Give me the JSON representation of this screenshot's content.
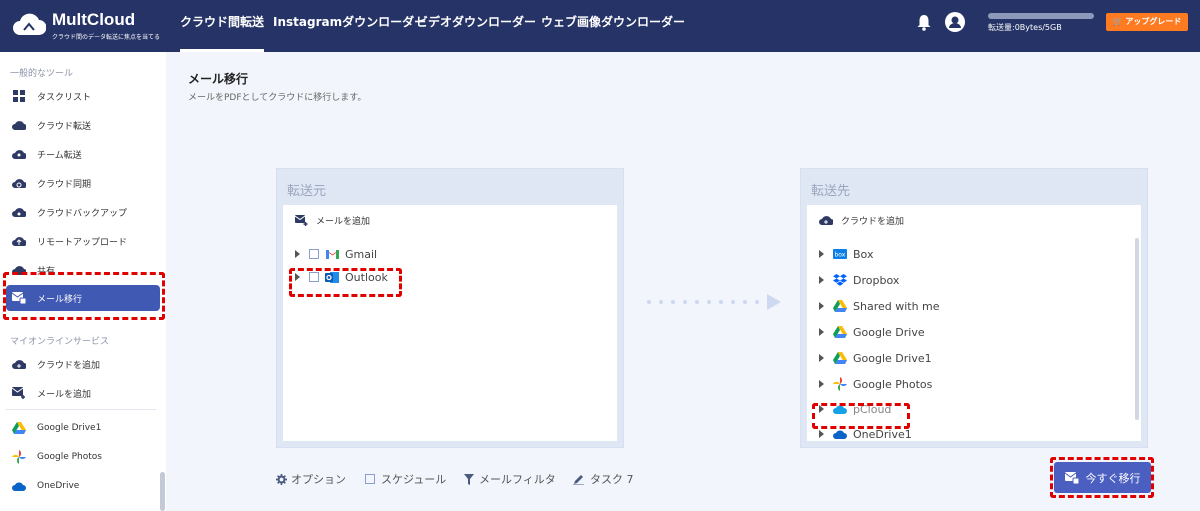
{
  "app": {
    "name": "MultCloud",
    "tagline": "クラウド間のデータ転送に焦点を当てる"
  },
  "topnav": [
    {
      "label": "クラウド間転送",
      "active": true
    },
    {
      "label": "Instagramダウンローダー",
      "active": false
    },
    {
      "label": "ビデオダウンローダー",
      "active": false
    },
    {
      "label": "ウェブ画像ダウンローダー",
      "active": false
    }
  ],
  "header": {
    "usage": "転送量:0Bytes/5GB",
    "usage_fraction": 0,
    "upgrade": "アップグレード"
  },
  "sidebar": {
    "section1": "一般的なツール",
    "items": [
      {
        "label": "タスクリスト",
        "icon": "grid-icon"
      },
      {
        "label": "クラウド転送",
        "icon": "cloud-transfer-icon"
      },
      {
        "label": "チーム転送",
        "icon": "team-transfer-icon"
      },
      {
        "label": "クラウド同期",
        "icon": "cloud-sync-icon"
      },
      {
        "label": "クラウドバックアップ",
        "icon": "cloud-backup-icon"
      },
      {
        "label": "リモートアップロード",
        "icon": "remote-upload-icon"
      },
      {
        "label": "共有",
        "icon": "share-icon"
      },
      {
        "label": "メール移行",
        "icon": "email-migration-icon",
        "active": true
      }
    ],
    "section2": "マイオンラインサービス",
    "services": [
      {
        "label": "クラウドを追加",
        "icon": "add-cloud-icon"
      },
      {
        "label": "メールを追加",
        "icon": "add-email-icon"
      },
      {
        "label": "Google Drive1",
        "icon": "google-drive-icon"
      },
      {
        "label": "Google Photos",
        "icon": "google-photos-icon"
      },
      {
        "label": "OneDrive",
        "icon": "onedrive-icon"
      }
    ]
  },
  "main": {
    "title": "メール移行",
    "description": "メールをPDFとしてクラウドに移行します。",
    "source": {
      "title": "転送元",
      "add": "メールを追加",
      "items": [
        "Gmail",
        "Outlook"
      ]
    },
    "dest": {
      "title": "転送先",
      "add": "クラウドを追加",
      "items": [
        "Box",
        "Dropbox",
        "Shared with me",
        "Google Drive",
        "Google Drive1",
        "Google Photos",
        "pCloud",
        "OneDrive1"
      ]
    },
    "options": {
      "option": "オプション",
      "schedule": "スケジュール",
      "filter": "メールフィルタ",
      "task": "タスク 7"
    },
    "go": "今すぐ移行"
  },
  "colors": {
    "topbar": "#253366",
    "accent": "#4059b3",
    "upgrade": "#ff7b21",
    "highlight": "#e00000"
  }
}
